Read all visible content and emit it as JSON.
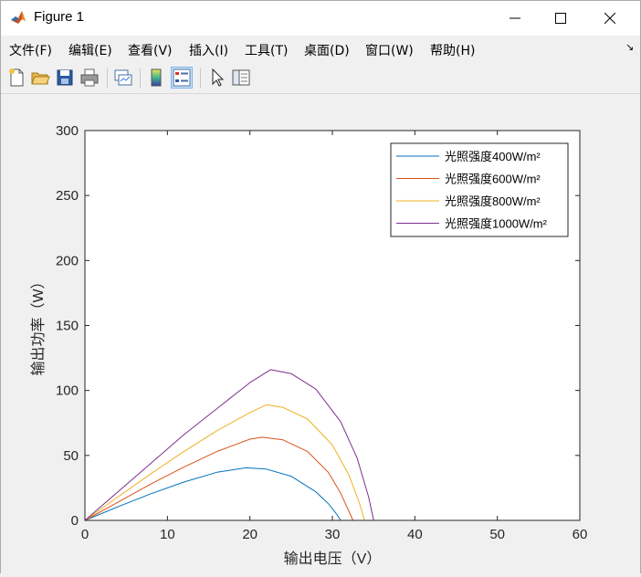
{
  "window": {
    "title": "Figure 1"
  },
  "menu": {
    "items": [
      {
        "label": "文件(F)"
      },
      {
        "label": "编辑(E)"
      },
      {
        "label": "查看(V)"
      },
      {
        "label": "插入(I)"
      },
      {
        "label": "工具(T)"
      },
      {
        "label": "桌面(D)"
      },
      {
        "label": "窗口(W)"
      },
      {
        "label": "帮助(H)"
      }
    ]
  },
  "toolbar": {
    "buttons": [
      {
        "icon": "new-figure-icon"
      },
      {
        "icon": "open-file-icon"
      },
      {
        "icon": "save-icon"
      },
      {
        "icon": "print-icon"
      },
      {
        "icon": "link-plot-icon"
      },
      {
        "icon": "colorbar-icon"
      },
      {
        "icon": "legend-icon",
        "active": true
      },
      {
        "icon": "edit-plot-cursor-icon"
      },
      {
        "icon": "property-inspector-icon"
      }
    ]
  },
  "colors": {
    "accent": "#cce4f7",
    "series": [
      "#0072bd",
      "#d95319",
      "#edb120",
      "#7e2f8e"
    ]
  },
  "chart_data": {
    "type": "line",
    "title": "",
    "xlabel": "输出电压（V）",
    "ylabel": "输出功率（W）",
    "xlim": [
      0,
      60
    ],
    "ylim": [
      0,
      300
    ],
    "xticks": [
      "0",
      "10",
      "20",
      "30",
      "40",
      "50",
      "60"
    ],
    "yticks": [
      "0",
      "50",
      "100",
      "150",
      "200",
      "250",
      "300"
    ],
    "grid": false,
    "legend": "top-right",
    "series": [
      {
        "name": "光照强度400W/m²",
        "x": [
          0,
          4,
          8,
          12,
          16,
          19.5,
          22,
          25,
          28,
          29.5,
          30.5,
          31.0
        ],
        "y": [
          0,
          10.5,
          20.5,
          29.5,
          37,
          40.5,
          39.5,
          34,
          22,
          13,
          5,
          0
        ]
      },
      {
        "name": "光照强度600W/m²",
        "x": [
          0,
          4,
          8,
          12,
          16,
          20,
          21.5,
          24,
          27,
          29.5,
          31,
          32.0,
          32.5
        ],
        "y": [
          0,
          14,
          28,
          41,
          53,
          62.5,
          64,
          62,
          53,
          37,
          21,
          7,
          0
        ]
      },
      {
        "name": "光照强度800W/m²",
        "x": [
          0,
          4,
          8,
          12,
          16,
          20,
          22,
          24,
          27,
          30,
          32,
          33.3,
          33.9
        ],
        "y": [
          0,
          18,
          36,
          53,
          69,
          83,
          89,
          87,
          78,
          58,
          35,
          13,
          0
        ]
      },
      {
        "name": "光照强度1000W/m²",
        "x": [
          0,
          4,
          8,
          12,
          16,
          20,
          22.5,
          25,
          28,
          31,
          33,
          34.4,
          35.0
        ],
        "y": [
          0,
          22,
          44,
          66,
          86,
          106,
          116,
          113,
          101,
          76,
          48,
          18,
          0
        ]
      }
    ]
  }
}
